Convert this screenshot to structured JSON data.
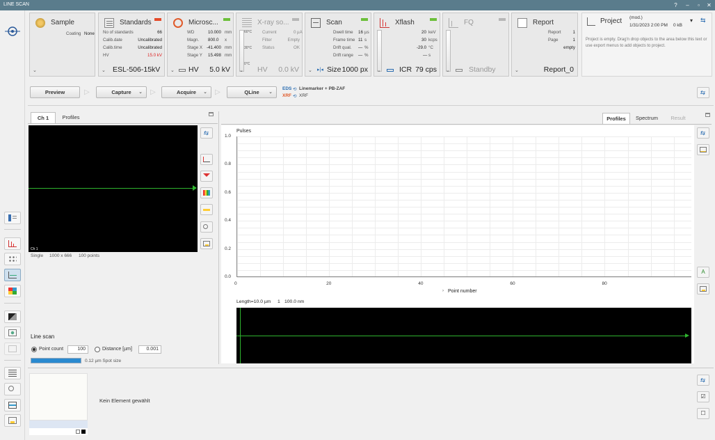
{
  "window": {
    "title": "LINE SCAN",
    "controls": [
      "?",
      "–",
      "▫",
      "✕"
    ]
  },
  "sample": {
    "title": "Sample",
    "coating_label": "Coating",
    "coating_value": "None"
  },
  "standards": {
    "title": "Standards",
    "rows": [
      [
        "No of standards",
        "66"
      ],
      [
        "Calib.date",
        "Uncalibrated"
      ],
      [
        "Calib.time",
        "Uncalibrated"
      ],
      [
        "HV",
        "15.0 kV"
      ]
    ],
    "value": "ESL-506-15kV"
  },
  "microscope": {
    "title": "Microsc...",
    "rows": [
      [
        "WD",
        "10.000",
        "mm"
      ],
      [
        "Magn.",
        "800.0",
        "x"
      ],
      [
        "Stage X",
        "-41.400",
        "mm"
      ],
      [
        "Stage Y",
        "15.498",
        "mm"
      ]
    ],
    "hv_label": "HV",
    "hv_value": "5.0 kV"
  },
  "xraysource": {
    "title": "X-ray so...",
    "temps": [
      "60°C",
      "30°C",
      "0°C"
    ],
    "rows": [
      [
        "Current",
        "0",
        "µA"
      ],
      [
        "Filter",
        "Empty",
        ""
      ],
      [
        "Status",
        "OK",
        ""
      ]
    ],
    "hv_label": "HV",
    "hv_value": "0.0 kV"
  },
  "scan": {
    "title": "Scan",
    "rows": [
      [
        "Dwell time",
        "16",
        "µs"
      ],
      [
        "Frame time",
        "11",
        "s"
      ],
      [
        "Drift qual.",
        "—",
        "%"
      ],
      [
        "Drift range",
        "—",
        "%"
      ]
    ],
    "size_label": "Size",
    "size_value": "1000 px"
  },
  "xflash": {
    "title": "Xflash",
    "rows": [
      [
        "20",
        "keV"
      ],
      [
        "30",
        "kcps"
      ],
      [
        "-29.0",
        "°C"
      ],
      [
        "—",
        "s"
      ]
    ],
    "icr_label": "ICR",
    "icr_value": "79 cps"
  },
  "fq": {
    "title": "FQ",
    "status": "Standby"
  },
  "report": {
    "title": "Report",
    "rows": [
      [
        "Report",
        "1"
      ],
      [
        "Page",
        "1"
      ],
      [
        "",
        "empty"
      ]
    ],
    "value": "Report_0"
  },
  "project": {
    "title": "Project",
    "mod": "(mod.)",
    "date": "1/31/2023 2:00 PM",
    "size": "0 kB",
    "message": "Project is empty. Drag'n drop objects to the area below this text or use export menus to add objects to project."
  },
  "workflow": {
    "preview": "Preview",
    "capture": "Capture",
    "acquire": "Acquire",
    "qline": "QLine",
    "eds_tag": "EDS",
    "eds_text": "Linemarker + PB-ZAF",
    "xrf_tag": "XRF",
    "xrf_text": "XRF"
  },
  "image_panel": {
    "tabs": [
      "Ch 1",
      "Profiles"
    ],
    "channel": "Ch 1",
    "mode": "Single",
    "size": "1000 x 666",
    "points": "100 points"
  },
  "line_scan": {
    "title": "Line scan",
    "point_count_label": "Point count",
    "point_count": "100",
    "distance_label": "Distance [µm]",
    "distance": "0.001",
    "spot_size": "0.12 µm Spot size",
    "progress": 1.0
  },
  "right_panel": {
    "tabs": [
      "Profiles",
      "Spectrum",
      "Result"
    ]
  },
  "chart_data": {
    "type": "line",
    "ylabel": "Pulses",
    "xlabel": "Point number",
    "x_ticks": [
      0,
      20,
      40,
      60,
      80
    ],
    "y_ticks": [
      "0.0",
      "0.2",
      "0.4",
      "0.6",
      "0.8",
      "1.0"
    ],
    "xlim": [
      0,
      99
    ],
    "ylim": [
      0,
      1
    ],
    "series": [],
    "grid": true
  },
  "linescan_info": {
    "length": "Length=10.0 µm",
    "count": "1",
    "step": "100.0 nm"
  },
  "bottom": {
    "message": "Kein Element gewählt"
  },
  "colors": {
    "titlebar": "#5a7c8c",
    "accent_green": "#6cbf3a",
    "alert_red": "#e54b2a",
    "progress_blue": "#2a8ad0",
    "trace_green": "#2fb52f"
  }
}
